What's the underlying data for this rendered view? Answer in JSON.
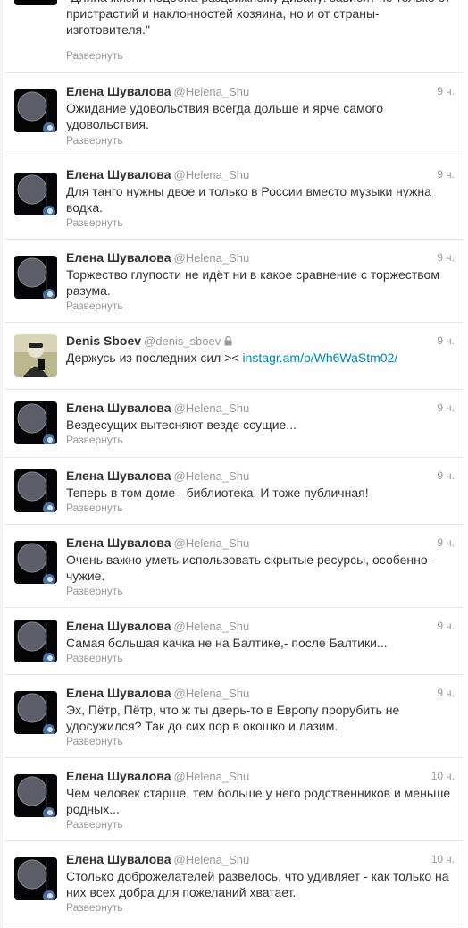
{
  "colors": {
    "link": "#0084b4",
    "name": "#333333",
    "meta": "#999999",
    "border": "#e8e8e8"
  },
  "tweets": [
    {
      "text": "\"Длина жизни подобна раздвижному дивану: зависит не только от пристрастий и наклонностей хозяина, но и от страны-изготовителя.\"",
      "expand": "Развернуть"
    },
    {
      "name": "Елена Шувалова",
      "handle": "@Helena_Shu",
      "time": "9 ч.",
      "text": "Ожидание удовольствия всегда дольше и ярче самого удовольствия.",
      "expand": "Развернуть",
      "avatar_icon": "space-planet-avatar"
    },
    {
      "name": "Елена Шувалова",
      "handle": "@Helena_Shu",
      "time": "9 ч.",
      "text": "Для танго нужны двое и только в России вместо музыки нужна водка.",
      "expand": "Развернуть",
      "avatar_icon": "space-planet-avatar"
    },
    {
      "name": "Елена Шувалова",
      "handle": "@Helena_Shu",
      "time": "9 ч.",
      "text": "Торжество глупости не идёт ни в какое сравнение с торжеством разума.",
      "expand": "Развернуть",
      "avatar_icon": "space-planet-avatar"
    },
    {
      "name": "Denis Sboev",
      "handle": "@denis_sboev",
      "time": "9 ч.",
      "text": "Держусь из последних сил ><",
      "link": "instagr.am/p/Wh6WaStm02/",
      "expand": "Развернуть",
      "avatar_icon": "person-photo-avatar",
      "protected_icon": "lock-icon"
    },
    {
      "name": "Елена Шувалова",
      "handle": "@Helena_Shu",
      "time": "9 ч.",
      "text": "Вездесущих вытесняют везде ссущие...",
      "expand": "Развернуть",
      "avatar_icon": "space-planet-avatar"
    },
    {
      "name": "Елена Шувалова",
      "handle": "@Helena_Shu",
      "time": "9 ч.",
      "text": "Теперь в том доме - библиотека. И тоже публичная!",
      "expand": "Развернуть",
      "avatar_icon": "space-planet-avatar"
    },
    {
      "name": "Елена Шувалова",
      "handle": "@Helena_Shu",
      "time": "9 ч.",
      "text": "Очень важно уметь использовать скрытые ресурсы, особенно - чужие.",
      "expand": "Развернуть",
      "avatar_icon": "space-planet-avatar"
    },
    {
      "name": "Елена Шувалова",
      "handle": "@Helena_Shu",
      "time": "9 ч.",
      "text": "Самая большая качка не на Балтике,- после Балтики...",
      "expand": "Развернуть",
      "avatar_icon": "space-planet-avatar"
    },
    {
      "name": "Елена Шувалова",
      "handle": "@Helena_Shu",
      "time": "9 ч.",
      "text": "Эх, Пётр, Пётр, что ж ты дверь-то в Европу прорубить не удосужился? Так до сих пор в окошко и лазим.",
      "expand": "Развернуть",
      "avatar_icon": "space-planet-avatar"
    },
    {
      "name": "Елена Шувалова",
      "handle": "@Helena_Shu",
      "time": "10 ч.",
      "text": "Чем человек старше, тем больше у него родственников и меньше родных...",
      "expand": "Развернуть",
      "avatar_icon": "space-planet-avatar"
    },
    {
      "name": "Елена Шувалова",
      "handle": "@Helena_Shu",
      "time": "10 ч.",
      "text": "Столько доброжелателей развелось, что удивляет - как только на них всех добра для пожеланий хватает.",
      "expand": "Развернуть",
      "avatar_icon": "space-planet-avatar"
    }
  ]
}
